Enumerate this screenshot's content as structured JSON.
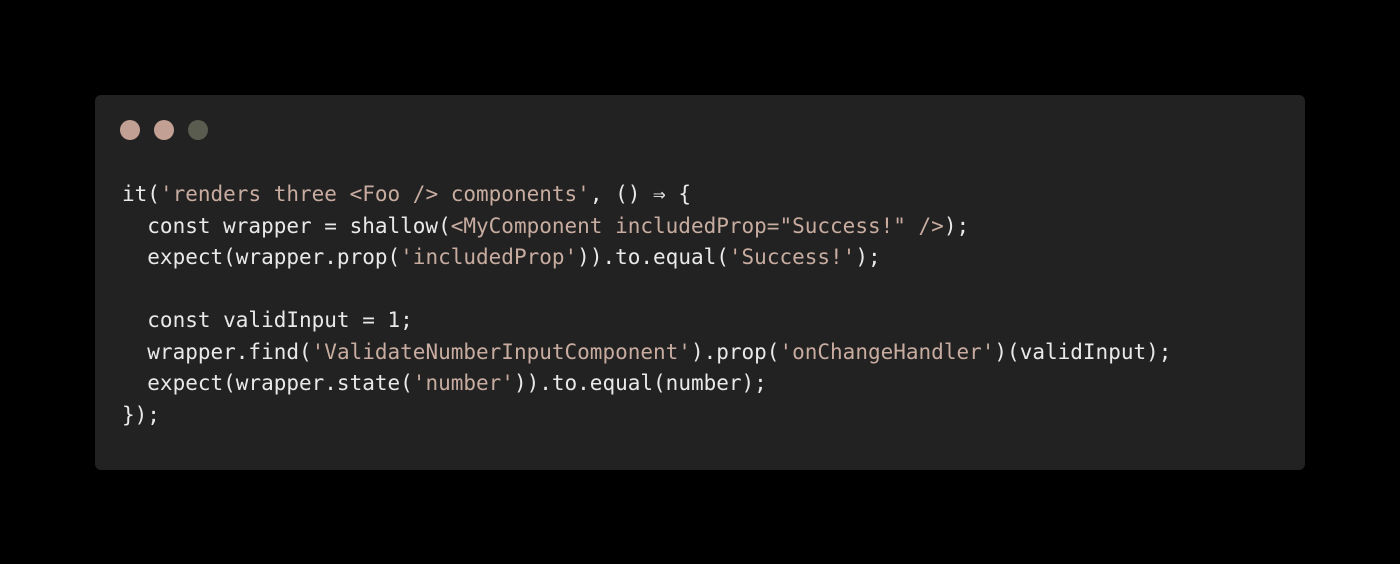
{
  "window": {
    "traffic_lights": [
      {
        "name": "close",
        "color": "#c2a094"
      },
      {
        "name": "minimize",
        "color": "#c2a094"
      },
      {
        "name": "zoom",
        "color": "#5a5c4f"
      }
    ]
  },
  "colors": {
    "background": "#000000",
    "editor_bg": "#222222",
    "text": "#e9e9e9",
    "string": "#c8aca0"
  },
  "code": {
    "lines": [
      [
        {
          "t": "it("
        },
        {
          "t": "'renders three <Foo /> components'",
          "k": "str"
        },
        {
          "t": ", () ⇒ {"
        }
      ],
      [
        {
          "t": "  const wrapper = shallow("
        },
        {
          "t": "<MyComponent includedProp=\"Success!\" />",
          "k": "str"
        },
        {
          "t": ");"
        }
      ],
      [
        {
          "t": "  expect(wrapper.prop("
        },
        {
          "t": "'includedProp'",
          "k": "str"
        },
        {
          "t": ")).to.equal("
        },
        {
          "t": "'Success!'",
          "k": "str"
        },
        {
          "t": ");"
        }
      ],
      [
        {
          "t": ""
        }
      ],
      [
        {
          "t": "  const validInput = 1;"
        }
      ],
      [
        {
          "t": "  wrapper.find("
        },
        {
          "t": "'ValidateNumberInputComponent'",
          "k": "str"
        },
        {
          "t": ").prop("
        },
        {
          "t": "'onChangeHandler'",
          "k": "str"
        },
        {
          "t": ")(validInput);"
        }
      ],
      [
        {
          "t": "  expect(wrapper.state("
        },
        {
          "t": "'number'",
          "k": "str"
        },
        {
          "t": ")).to.equal(number);"
        }
      ],
      [
        {
          "t": "});"
        }
      ]
    ]
  }
}
